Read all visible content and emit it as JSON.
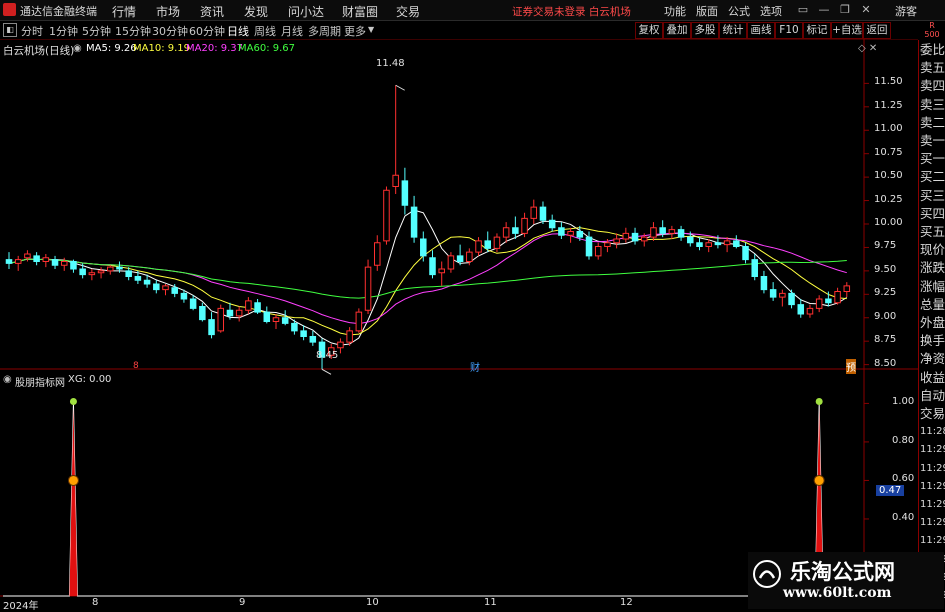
{
  "app": {
    "name": "通达信金融终端",
    "notice": "证券交易未登录  白云机场"
  },
  "menu": [
    "行情",
    "市场",
    "资讯",
    "发现",
    "问小达",
    "财富圈",
    "交易"
  ],
  "right_menu": [
    "功能",
    "版面",
    "公式",
    "选项",
    "游客"
  ],
  "toolbar": {
    "periods": [
      "分时",
      "1分钟",
      "5分钟",
      "15分钟",
      "30分钟",
      "60分钟",
      "日线",
      "周线",
      "月线",
      "多周期",
      "更多"
    ],
    "active": "日线",
    "buttons": [
      "复权",
      "叠加",
      "多股",
      "统计",
      "画线",
      "F10",
      "标记",
      "+自选",
      "返回"
    ]
  },
  "badge": [
    "R",
    "500"
  ],
  "main_chart": {
    "title": "白云机场(日线)",
    "ma": [
      {
        "label": "MA5: 9.26",
        "color": "#ffffff"
      },
      {
        "label": "MA10: 9.19",
        "color": "#ffff40"
      },
      {
        "label": "MA20: 9.37",
        "color": "#ff40ff"
      },
      {
        "label": "MA60: 9.67",
        "color": "#40ff40"
      }
    ],
    "high_label": "11.48",
    "low_label": "8.45",
    "markers": [
      "8",
      "财",
      "预"
    ]
  },
  "sub_chart": {
    "title": "股朋指标网",
    "xg": "XG: 0.00",
    "cursor_value": "0.47"
  },
  "right_panel": [
    "委比",
    "卖五",
    "卖四",
    "卖三",
    "卖二",
    "卖一",
    "买一",
    "买二",
    "买三",
    "买四",
    "买五",
    "现价",
    "涨跌",
    "涨幅",
    "总量",
    "外盘",
    "换手",
    "净资",
    "收益",
    "自动",
    "交易",
    "11:28",
    "11:29",
    "11:29",
    "11:29",
    "11:29",
    "11:29",
    "11:29",
    "11:29",
    "11:29",
    "11:29"
  ],
  "x_labels": [
    "2024年",
    "8",
    "9",
    "10",
    "11",
    "12"
  ],
  "watermark": {
    "text": "乐淘公式网",
    "url": "www.60lt.com"
  },
  "chart_data": [
    {
      "type": "candlestick",
      "title": "白云机场(日线)",
      "y_ticks": [
        11.5,
        11.25,
        11.0,
        10.75,
        10.5,
        10.25,
        10.0,
        9.75,
        9.5,
        9.25,
        9.0,
        8.75,
        8.5
      ],
      "ylim": [
        8.4,
        11.6
      ],
      "candles": [
        [
          9.62,
          9.7,
          9.52,
          9.58
        ],
        [
          9.58,
          9.66,
          9.5,
          9.62
        ],
        [
          9.64,
          9.72,
          9.6,
          9.68
        ],
        [
          9.66,
          9.7,
          9.56,
          9.6
        ],
        [
          9.6,
          9.68,
          9.54,
          9.64
        ],
        [
          9.62,
          9.66,
          9.52,
          9.56
        ],
        [
          9.56,
          9.64,
          9.5,
          9.6
        ],
        [
          9.6,
          9.62,
          9.48,
          9.52
        ],
        [
          9.52,
          9.58,
          9.42,
          9.46
        ],
        [
          9.46,
          9.52,
          9.4,
          9.48
        ],
        [
          9.48,
          9.54,
          9.42,
          9.5
        ],
        [
          9.5,
          9.56,
          9.46,
          9.54
        ],
        [
          9.54,
          9.6,
          9.48,
          9.52
        ],
        [
          9.5,
          9.54,
          9.4,
          9.44
        ],
        [
          9.44,
          9.5,
          9.36,
          9.4
        ],
        [
          9.4,
          9.46,
          9.32,
          9.36
        ],
        [
          9.36,
          9.4,
          9.26,
          9.3
        ],
        [
          9.3,
          9.36,
          9.24,
          9.34
        ],
        [
          9.32,
          9.36,
          9.22,
          9.26
        ],
        [
          9.26,
          9.3,
          9.16,
          9.2
        ],
        [
          9.2,
          9.24,
          9.08,
          9.1
        ],
        [
          9.12,
          9.16,
          8.96,
          8.98
        ],
        [
          8.98,
          9.06,
          8.78,
          8.82
        ],
        [
          8.86,
          9.14,
          8.84,
          9.1
        ],
        [
          9.08,
          9.16,
          8.98,
          9.02
        ],
        [
          9.02,
          9.12,
          8.96,
          9.08
        ],
        [
          9.08,
          9.22,
          9.04,
          9.18
        ],
        [
          9.16,
          9.2,
          9.04,
          9.06
        ],
        [
          9.06,
          9.12,
          8.94,
          8.96
        ],
        [
          8.96,
          9.04,
          8.88,
          9.0
        ],
        [
          9.0,
          9.08,
          8.92,
          8.94
        ],
        [
          8.94,
          8.98,
          8.82,
          8.86
        ],
        [
          8.86,
          8.92,
          8.76,
          8.8
        ],
        [
          8.8,
          8.86,
          8.7,
          8.74
        ],
        [
          8.74,
          8.78,
          8.45,
          8.58
        ],
        [
          8.6,
          8.72,
          8.56,
          8.68
        ],
        [
          8.68,
          8.78,
          8.62,
          8.74
        ],
        [
          8.74,
          8.9,
          8.7,
          8.86
        ],
        [
          8.86,
          9.1,
          8.84,
          9.06
        ],
        [
          9.08,
          9.62,
          9.04,
          9.54
        ],
        [
          9.56,
          9.88,
          9.5,
          9.8
        ],
        [
          9.82,
          10.4,
          9.78,
          10.36
        ],
        [
          10.4,
          11.48,
          10.32,
          10.52
        ],
        [
          10.46,
          10.6,
          10.1,
          10.2
        ],
        [
          10.18,
          10.3,
          9.8,
          9.86
        ],
        [
          9.84,
          9.92,
          9.6,
          9.66
        ],
        [
          9.64,
          9.72,
          9.42,
          9.46
        ],
        [
          9.48,
          9.6,
          9.34,
          9.52
        ],
        [
          9.52,
          9.7,
          9.48,
          9.66
        ],
        [
          9.66,
          9.78,
          9.56,
          9.6
        ],
        [
          9.6,
          9.74,
          9.56,
          9.7
        ],
        [
          9.7,
          9.86,
          9.66,
          9.82
        ],
        [
          9.82,
          9.92,
          9.7,
          9.74
        ],
        [
          9.74,
          9.9,
          9.7,
          9.86
        ],
        [
          9.86,
          10.02,
          9.8,
          9.96
        ],
        [
          9.96,
          10.08,
          9.84,
          9.9
        ],
        [
          9.9,
          10.12,
          9.86,
          10.06
        ],
        [
          10.06,
          10.26,
          10.0,
          10.18
        ],
        [
          10.18,
          10.24,
          10.0,
          10.04
        ],
        [
          10.04,
          10.1,
          9.92,
          9.96
        ],
        [
          9.96,
          10.02,
          9.84,
          9.88
        ],
        [
          9.88,
          9.96,
          9.8,
          9.92
        ],
        [
          9.92,
          9.98,
          9.82,
          9.86
        ],
        [
          9.86,
          9.92,
          9.62,
          9.66
        ],
        [
          9.66,
          9.8,
          9.62,
          9.76
        ],
        [
          9.76,
          9.84,
          9.7,
          9.8
        ],
        [
          9.8,
          9.9,
          9.74,
          9.84
        ],
        [
          9.84,
          9.96,
          9.8,
          9.9
        ],
        [
          9.9,
          9.96,
          9.78,
          9.82
        ],
        [
          9.82,
          9.9,
          9.76,
          9.86
        ],
        [
          9.86,
          10.02,
          9.82,
          9.96
        ],
        [
          9.96,
          10.04,
          9.86,
          9.9
        ],
        [
          9.9,
          9.98,
          9.84,
          9.94
        ],
        [
          9.94,
          9.98,
          9.82,
          9.86
        ],
        [
          9.86,
          9.92,
          9.76,
          9.8
        ],
        [
          9.8,
          9.86,
          9.72,
          9.76
        ],
        [
          9.76,
          9.84,
          9.7,
          9.8
        ],
        [
          9.8,
          9.88,
          9.74,
          9.78
        ],
        [
          9.78,
          9.86,
          9.7,
          9.82
        ],
        [
          9.82,
          9.88,
          9.74,
          9.76
        ],
        [
          9.76,
          9.8,
          9.58,
          9.62
        ],
        [
          9.62,
          9.68,
          9.4,
          9.44
        ],
        [
          9.44,
          9.5,
          9.26,
          9.3
        ],
        [
          9.3,
          9.38,
          9.18,
          9.22
        ],
        [
          9.22,
          9.3,
          9.12,
          9.26
        ],
        [
          9.26,
          9.3,
          9.1,
          9.14
        ],
        [
          9.14,
          9.2,
          9.0,
          9.04
        ],
        [
          9.04,
          9.14,
          9.0,
          9.1
        ],
        [
          9.1,
          9.24,
          9.06,
          9.2
        ],
        [
          9.2,
          9.28,
          9.12,
          9.16
        ],
        [
          9.16,
          9.32,
          9.14,
          9.28
        ],
        [
          9.28,
          9.38,
          9.22,
          9.34
        ]
      ]
    },
    {
      "type": "line",
      "title": "股朋指标网",
      "y_ticks": [
        1.0,
        0.8,
        0.6,
        0.4
      ],
      "ylim": [
        0,
        1.08
      ],
      "signal_days": [
        7,
        88
      ]
    }
  ]
}
